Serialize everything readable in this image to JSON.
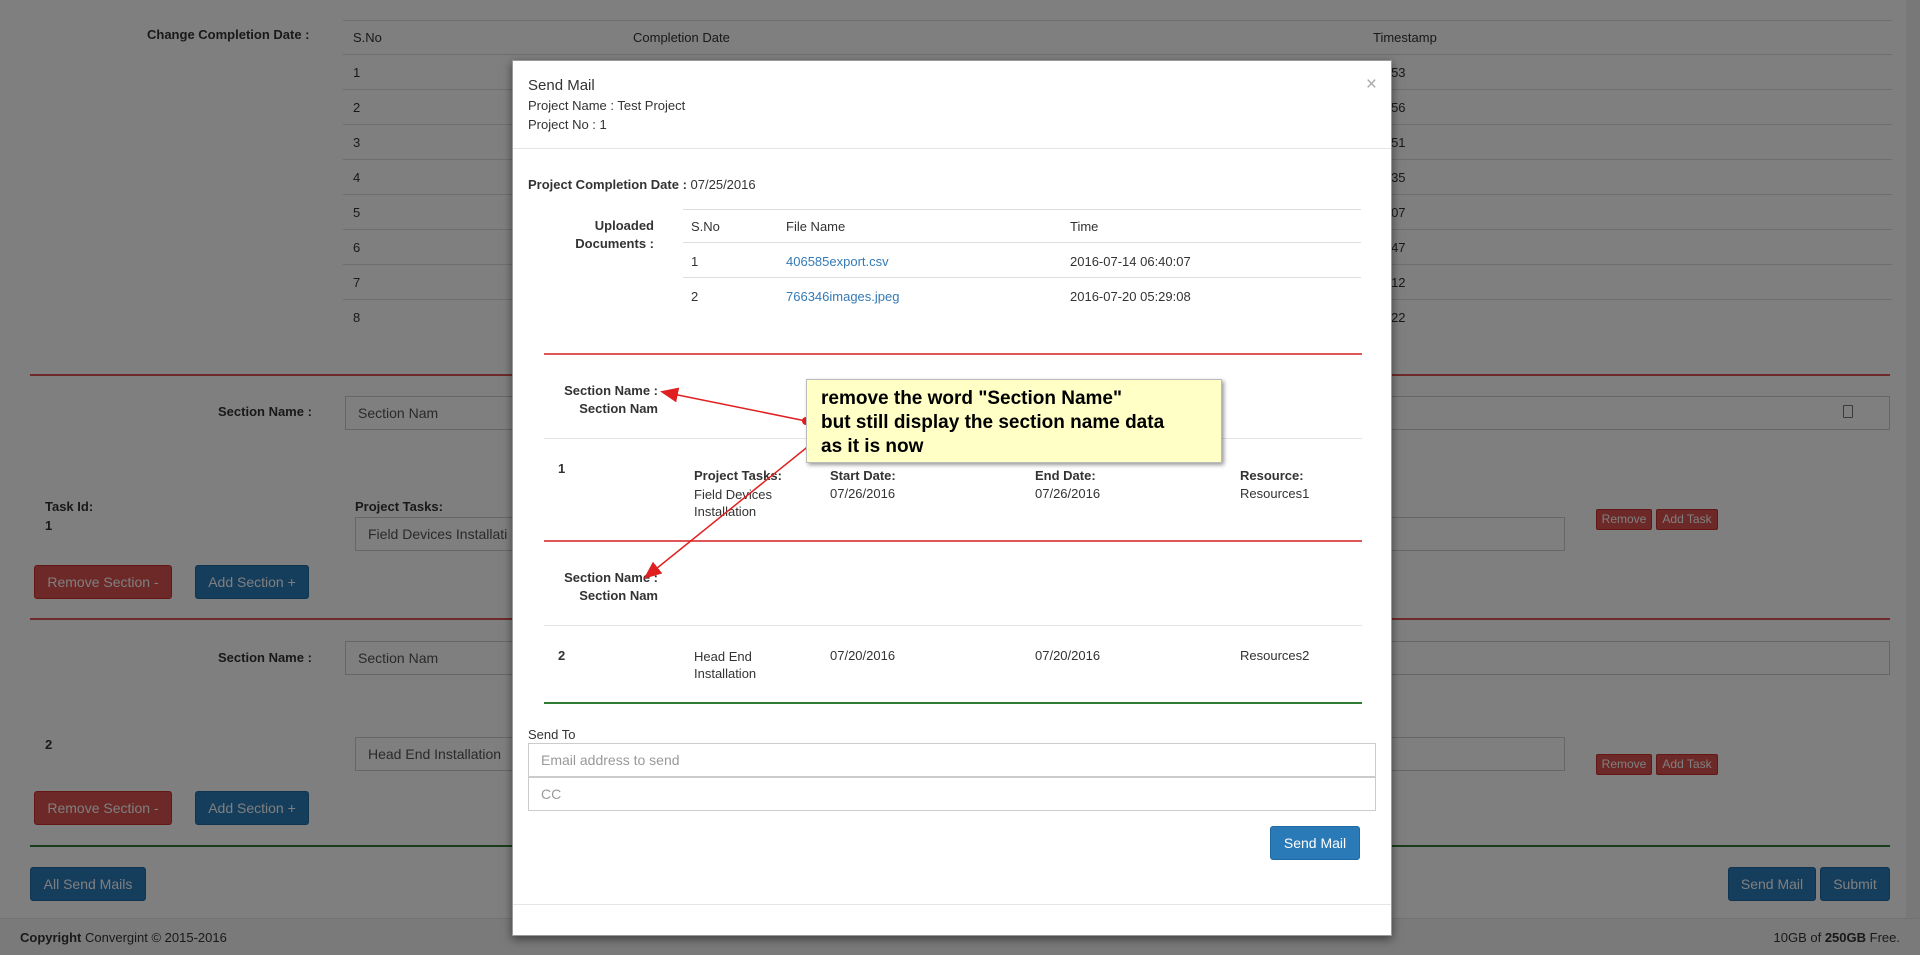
{
  "background": {
    "change_completion_label": "Change Completion Date :",
    "history_headers": [
      "S.No",
      "Completion Date",
      "Timestamp"
    ],
    "history_rows": [
      {
        "sno": "1",
        "ts": "20:53"
      },
      {
        "sno": "2",
        "ts": "18:56"
      },
      {
        "sno": "3",
        "ts": "10:51"
      },
      {
        "sno": "4",
        "ts": "10:35"
      },
      {
        "sno": "5",
        "ts": "09:07"
      },
      {
        "sno": "6",
        "ts": "08:47"
      },
      {
        "sno": "7",
        "ts": "07:12"
      },
      {
        "sno": "8",
        "ts": "23:22"
      }
    ],
    "sections": [
      {
        "section_label": "Section Name :",
        "section_value": "Section Nam",
        "task_id_label": "Task Id:",
        "task_id": "1",
        "project_tasks_label": "Project Tasks:",
        "task_value": "Field Devices Installati",
        "remove_label": "Remove",
        "add_task_label": "Add Task",
        "remove_section_label": "Remove Section -",
        "add_section_label": "Add Section +"
      },
      {
        "section_label": "Section Name :",
        "section_value": "Section Nam",
        "task_id": "2",
        "task_value": "Head End Installation",
        "remove_label": "Remove",
        "add_task_label": "Add Task",
        "remove_section_label": "Remove Section -",
        "add_section_label": "Add Section +"
      }
    ],
    "all_send_mails": "All Send Mails",
    "send_mail": "Send Mail",
    "submit": "Submit"
  },
  "modal": {
    "title": "Send Mail",
    "project_name": "Project Name : Test Project",
    "project_no": "Project No : 1",
    "close": "×",
    "completion_label": "Project Completion Date :",
    "completion_value": " 07/25/2016",
    "uploaded_label_1": "Uploaded",
    "uploaded_label_2": "Documents :",
    "doc_headers": [
      "S.No",
      "File Name",
      "Time"
    ],
    "docs": [
      {
        "sno": "1",
        "file": "406585export.csv",
        "time": "2016-07-14 06:40:07"
      },
      {
        "sno": "2",
        "file": "766346images.jpeg",
        "time": "2016-07-20 05:29:08"
      }
    ],
    "sections": [
      {
        "label": "Section Name :",
        "value": "Section Nam",
        "task_no": "1",
        "tasks_label": "Project Tasks:",
        "task": "Field Devices Installation",
        "start_label": "Start Date:",
        "start": "07/26/2016",
        "end_label": "End Date:",
        "end": "07/26/2016",
        "resource_label": "Resource:",
        "resource": "Resources1"
      },
      {
        "label": "Section Name :",
        "value": "Section Nam",
        "task_no": "2",
        "task": "Head End Installation",
        "start": "07/20/2016",
        "end": "07/20/2016",
        "resource": "Resources2"
      }
    ],
    "send_to_label": "Send To",
    "email_placeholder": "Email address to send",
    "cc_placeholder": "CC",
    "send_button": "Send Mail"
  },
  "annotation": {
    "line1": "remove the word \"Section Name\"",
    "line2": "but still display the section name data",
    "line3": "as it is now"
  },
  "footer": {
    "copyright_bold": "Copyright",
    "copyright_rest": " Convergint © 2015-2016",
    "storage_used": "10GB of ",
    "storage_total": "250GB",
    "storage_suffix": " Free."
  },
  "colors": {
    "accent_blue": "#2a7ab8",
    "danger_red": "#d9534f",
    "link_blue": "#337ab7",
    "divider_red": "#e05555",
    "divider_green": "#2e7d32",
    "callout_yellow": "#ffffc6"
  }
}
